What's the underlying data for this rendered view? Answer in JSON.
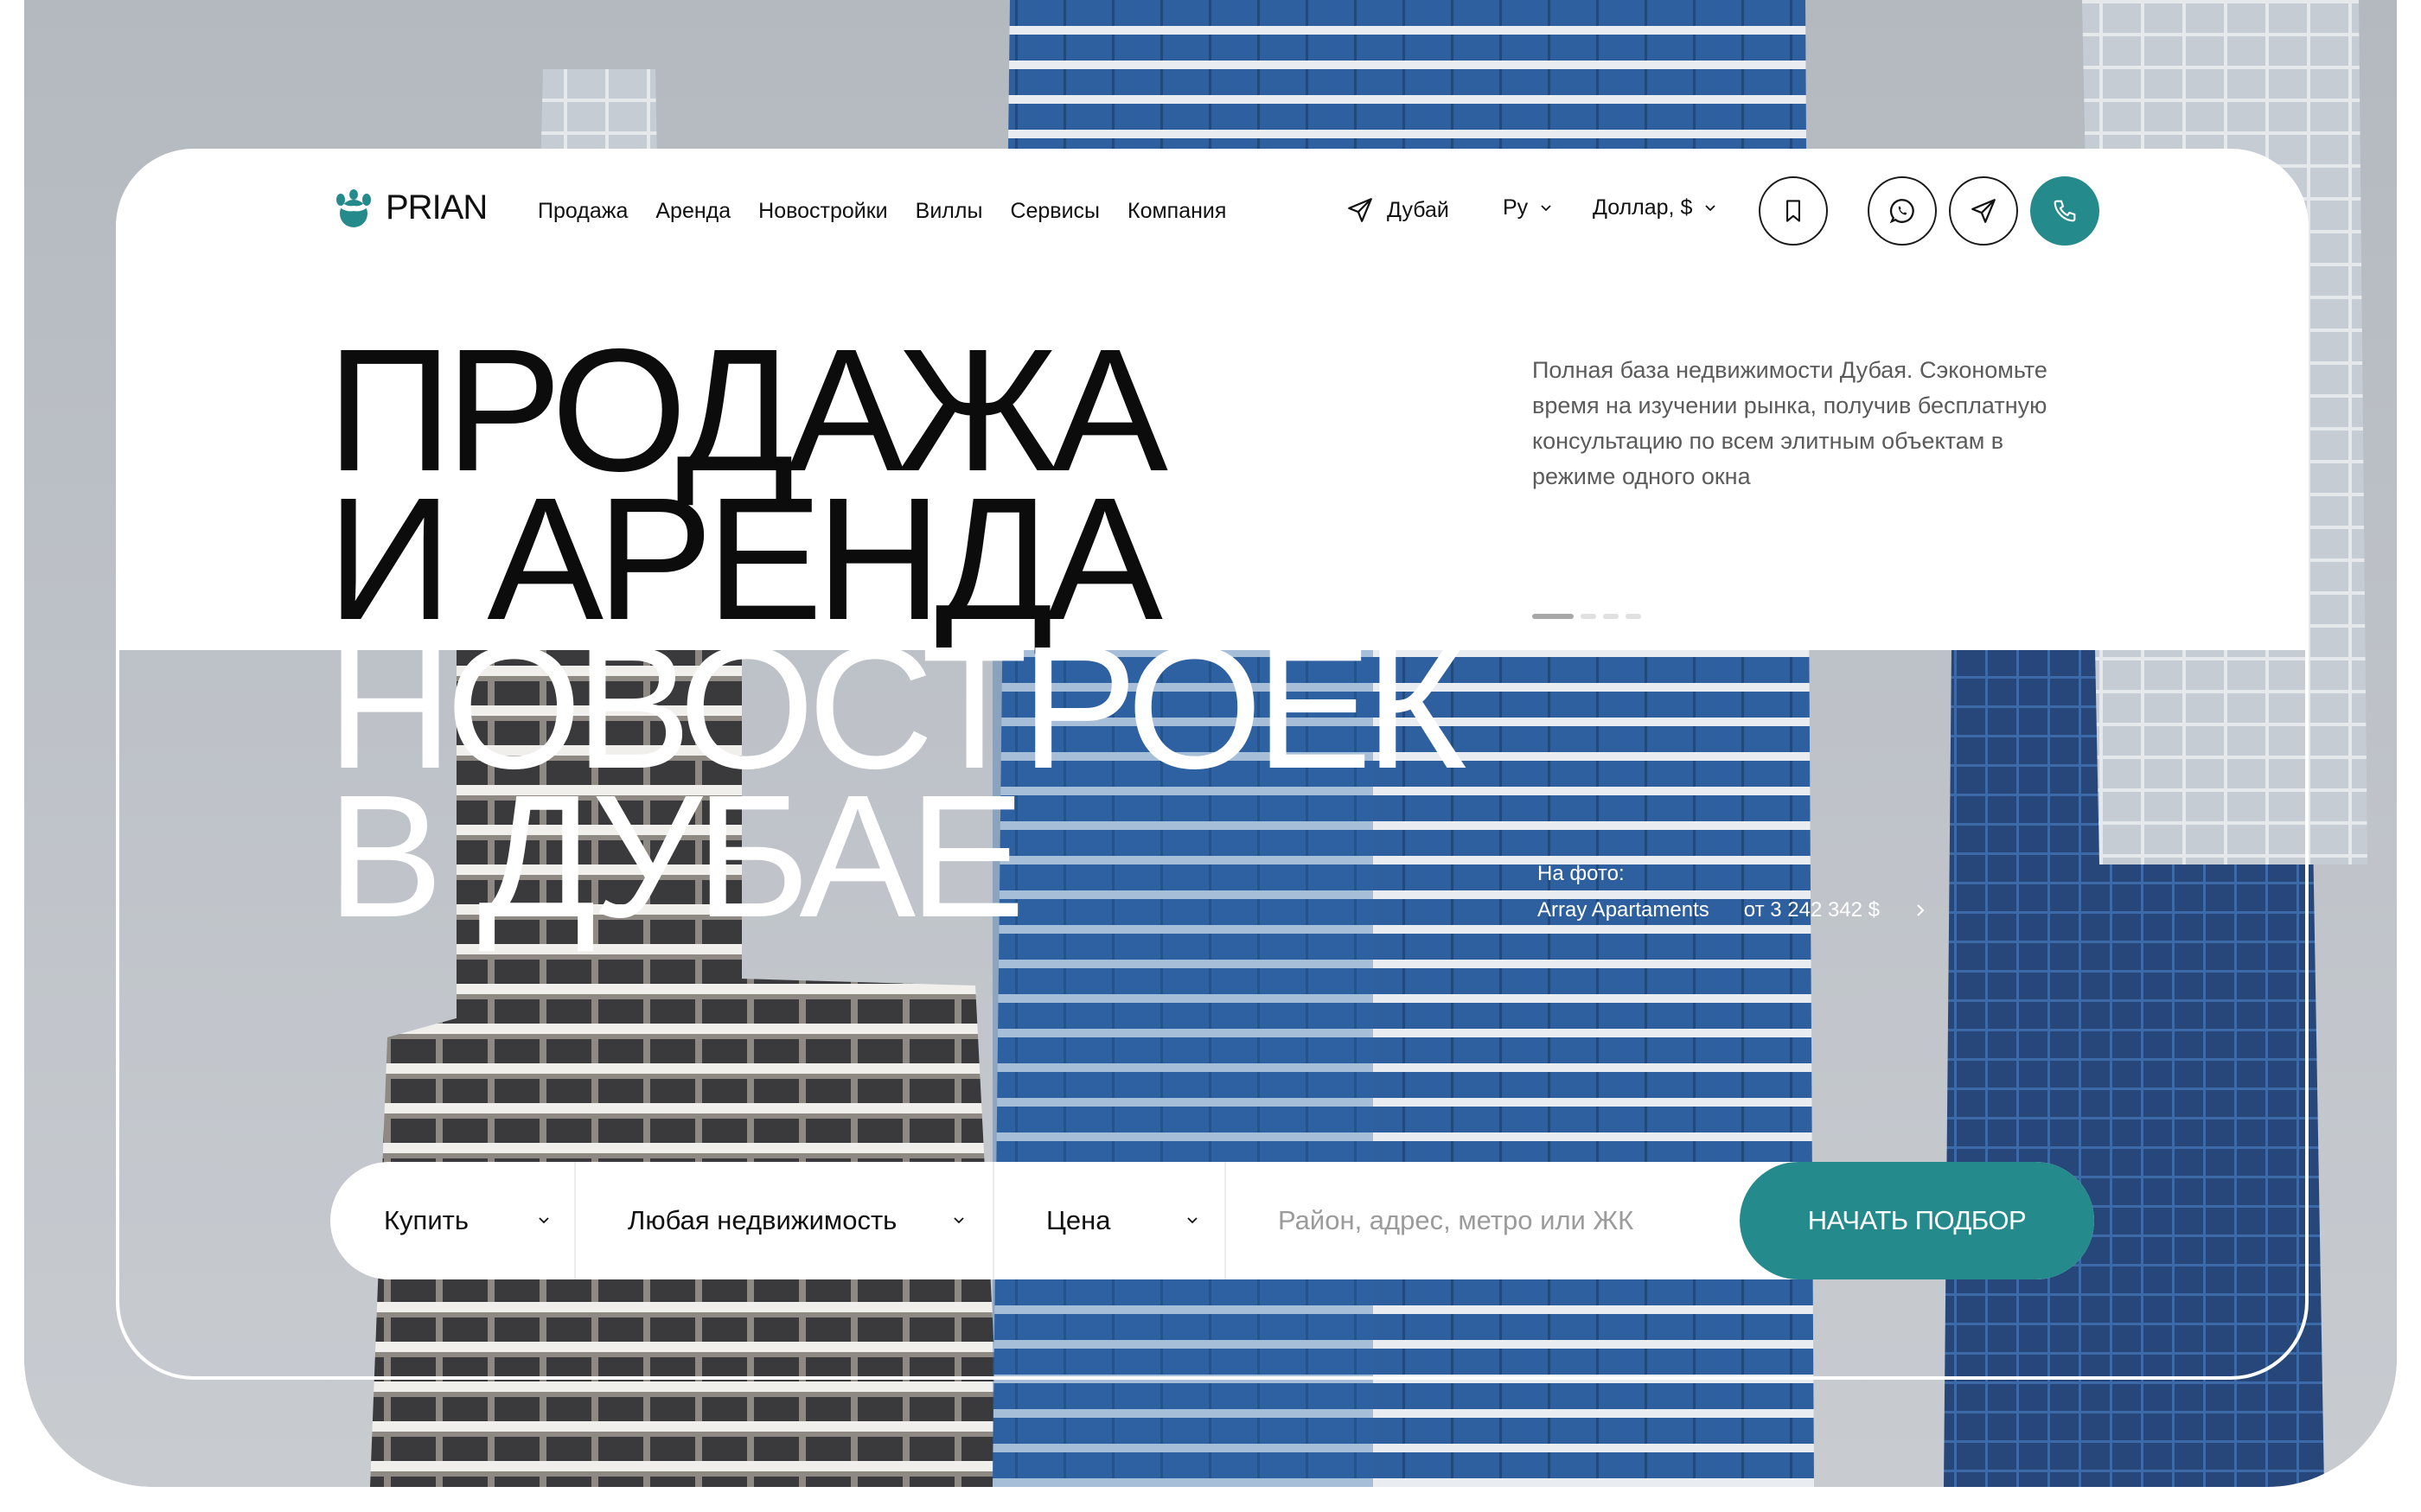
{
  "brand": {
    "name": "PRIAN",
    "accent_color": "#258a8c"
  },
  "nav": {
    "items": [
      "Продажа",
      "Аренда",
      "Новостройки",
      "Виллы",
      "Сервисы",
      "Компания"
    ]
  },
  "header": {
    "location": "Дубай",
    "language": "Ру",
    "currency": "Доллар, $",
    "icons": [
      "bookmark-icon",
      "whatsapp-icon",
      "telegram-icon",
      "phone-icon"
    ]
  },
  "hero": {
    "title_lines": [
      "ПРОДАЖА",
      "И АРЕНДА",
      "НОВОСТРОЕК",
      "В ДУБАЕ"
    ],
    "description": "Полная база недвижимости Дубая. Сэкономьте время на изучении рынка, получив бесплатную консультацию по всем элитным объектам в режиме одного окна",
    "slides_total": 4,
    "slide_active": 1
  },
  "photo_caption": {
    "label": "На фото:",
    "project": "Array Apartaments",
    "price": "от 3 242 342 $"
  },
  "search": {
    "deal_type": "Купить",
    "property_type": "Любая недвижимость",
    "price": "Цена",
    "location_placeholder": "Район, адрес, метро или ЖК",
    "submit_label": "НАЧАТЬ ПОДБОР"
  }
}
